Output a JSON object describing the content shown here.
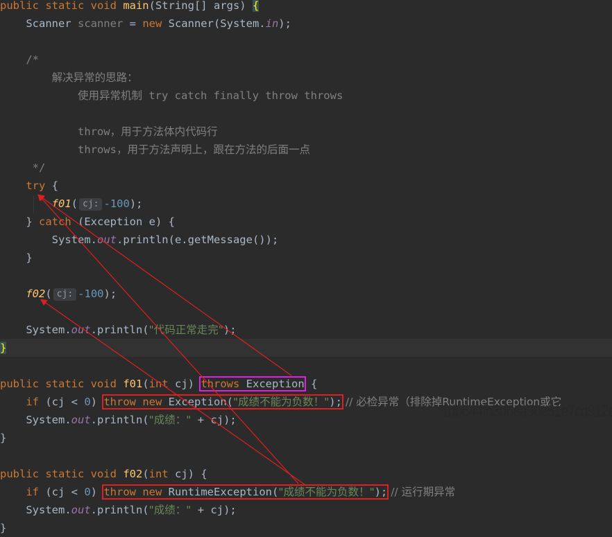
{
  "code": {
    "l1": {
      "kw": "public static void ",
      "fn": "main",
      "rest": "(String[] args) ",
      "brace": "{"
    },
    "l2": {
      "a": "Scanner ",
      "b": "scanner",
      "c": " = ",
      "kw": "new",
      "d": " Scanner(System.",
      "fld": "in",
      "e": ");"
    },
    "l4": "/*",
    "l5": "解决异常的思路：",
    "l6": "使用异常机制 try catch finally throw throws",
    "l8": "throw，用于方法体内代码行",
    "l9": "throws，用于方法声明上，跟在方法的后面一点",
    "l10": " */",
    "l11": {
      "kw": "try",
      "rest": " {"
    },
    "l12": {
      "fn": "f01",
      "open": "(",
      "hint": "cj:",
      "num": "-100",
      "close": ");"
    },
    "l13": {
      "a": "} ",
      "kw": "catch",
      "b": " (Exception e) {"
    },
    "l14": {
      "a": "System.",
      "fld": "out",
      "b": ".println(e.getMessage());"
    },
    "l15": "}",
    "l17": {
      "fn": "f02",
      "open": "(",
      "hint": "cj:",
      "num": "-100",
      "close": ");"
    },
    "l19": {
      "a": "System.",
      "fld": "out",
      "b": ".println(",
      "str": "\"代码正常走完\"",
      "c": ");"
    },
    "l20": "}",
    "l22": {
      "kw": "public static void ",
      "fn": "f01",
      "a": "(",
      "kw2": "int",
      "b": " cj) ",
      "kw3": "throws",
      "c": " Exception",
      "d": " {"
    },
    "l23": {
      "kw": "if",
      "a": " (cj < ",
      "num": "0",
      "b": ") ",
      "kw2": "throw new",
      "c": " Exception(",
      "str": "\"成绩不能为负数！\"",
      "d": ");",
      "cmt": " // 必检异常（排除掉RuntimeException或它"
    },
    "l24": {
      "a": "System.",
      "fld": "out",
      "b": ".println(",
      "str": "\"成绩：\"",
      "c": " + cj);"
    },
    "l25": "}",
    "l27": {
      "kw": "public static void ",
      "fn": "f02",
      "a": "(",
      "kw2": "int",
      "b": " cj) {"
    },
    "l28": {
      "kw": "if",
      "a": " (cj < ",
      "num": "0",
      "b": ") ",
      "kw2": "throw new",
      "c": " RuntimeException(",
      "str": "\"成绩不能为负数！\"",
      "d": ");",
      "cmt": " // 运行期异常"
    },
    "l29": {
      "a": "System.",
      "fld": "out",
      "b": ".println(",
      "str": "\"成绩：\"",
      "c": " + cj);"
    },
    "l30": "}"
  },
  "watermark": "1db644fb3d6ea90e51e7cd912e",
  "colors": {
    "keyword": "#cc7832",
    "function": "#ffc66d",
    "number": "#6897bb",
    "string": "#6a8759",
    "comment": "#808080",
    "field": "#9876aa",
    "annotation_red": "#e02020",
    "annotation_magenta": "#e020e0"
  }
}
